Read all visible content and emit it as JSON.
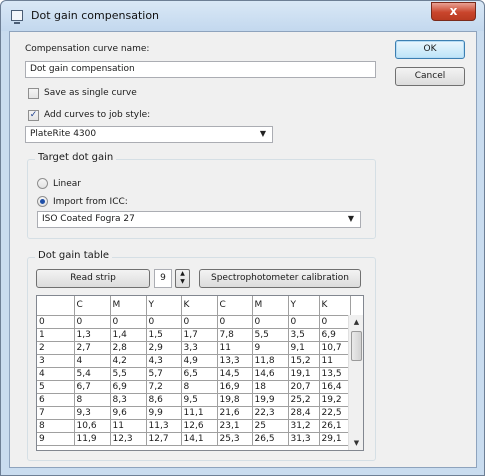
{
  "window": {
    "title": "Dot gain compensation",
    "close_glyph": "x"
  },
  "curve_name": {
    "label": "Compensation curve name:",
    "value": "Dot gain compensation"
  },
  "save_single": {
    "label": "Save as single curve",
    "checked": false
  },
  "add_curves": {
    "label": "Add curves to job style:",
    "checked": true,
    "check_glyph": "✓"
  },
  "job_style": {
    "value": "PlateRite 4300",
    "arrow": "▼"
  },
  "buttons": {
    "ok": "OK",
    "cancel": "Cancel"
  },
  "target_group": {
    "title": "Target dot gain",
    "linear_label": "Linear",
    "import_label": "Import from ICC:",
    "selected": "import",
    "icc_value": "ISO Coated Fogra 27",
    "arrow": "▼"
  },
  "table_group": {
    "title": "Dot gain table",
    "read_strip": "Read strip",
    "strip_count": "9",
    "spin_up": "▲",
    "spin_down": "▼",
    "spectro": "Spectrophotometer calibration"
  },
  "table": {
    "columns": [
      "",
      "C",
      "M",
      "Y",
      "K",
      "C",
      "M",
      "Y",
      "K"
    ],
    "rows": [
      [
        "0",
        "0",
        "0",
        "0",
        "0",
        "0",
        "0",
        "0",
        "0"
      ],
      [
        "1",
        "1,3",
        "1,4",
        "1,5",
        "1,7",
        "7,8",
        "5,5",
        "3,5",
        "6,9"
      ],
      [
        "2",
        "2,7",
        "2,8",
        "2,9",
        "3,3",
        "11",
        "9",
        "9,1",
        "10,7"
      ],
      [
        "3",
        "4",
        "4,2",
        "4,3",
        "4,9",
        "13,3",
        "11,8",
        "15,2",
        "11"
      ],
      [
        "4",
        "5,4",
        "5,5",
        "5,7",
        "6,5",
        "14,5",
        "14,6",
        "19,1",
        "13,5"
      ],
      [
        "5",
        "6,7",
        "6,9",
        "7,2",
        "8",
        "16,9",
        "18",
        "20,7",
        "16,4"
      ],
      [
        "6",
        "8",
        "8,3",
        "8,6",
        "9,5",
        "19,8",
        "19,9",
        "25,2",
        "19,2"
      ],
      [
        "7",
        "9,3",
        "9,6",
        "9,9",
        "11,1",
        "21,6",
        "22,3",
        "28,4",
        "22,5"
      ],
      [
        "8",
        "10,6",
        "11",
        "11,3",
        "12,6",
        "23,1",
        "25",
        "31,2",
        "26,1"
      ],
      [
        "9",
        "11,9",
        "12,3",
        "12,7",
        "14,1",
        "25,3",
        "26,5",
        "31,3",
        "29,1"
      ]
    ]
  },
  "scrollbar": {
    "up": "▲",
    "down": "▼"
  }
}
